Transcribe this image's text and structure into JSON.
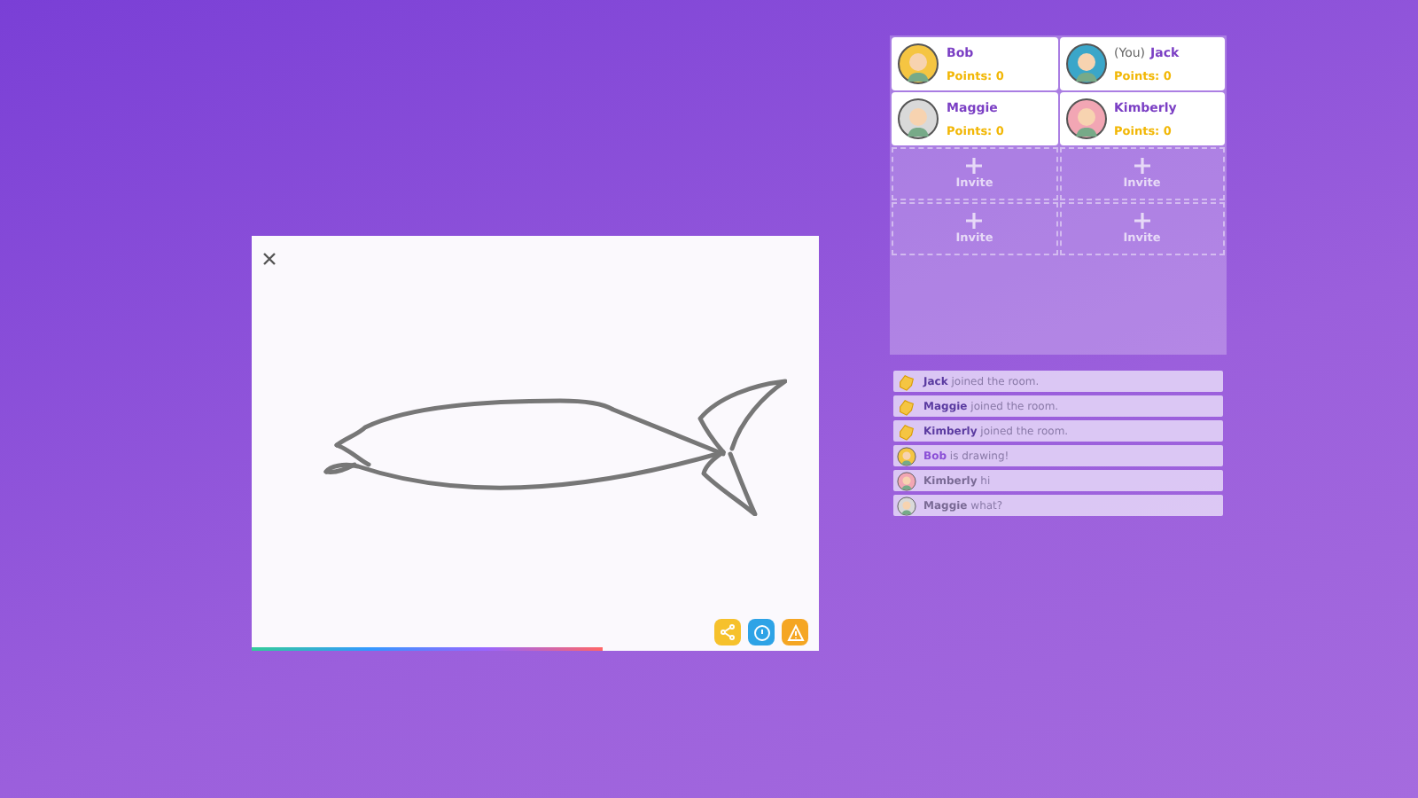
{
  "players": [
    {
      "name": "Bob",
      "points": "Points: 0",
      "color": "#f5c542"
    },
    {
      "name": "Jack",
      "you_label": "(You)",
      "points": "Points: 0",
      "color": "#3aa6c9"
    },
    {
      "name": "Maggie",
      "points": "Points: 0",
      "color": "#d9d9d9"
    },
    {
      "name": "Kimberly",
      "points": "Points: 0",
      "color": "#f2a6b4"
    }
  ],
  "invites": [
    "Invite",
    "Invite",
    "Invite",
    "Invite"
  ],
  "chat": [
    {
      "kind": "join",
      "name": "Jack",
      "text": "joined the room."
    },
    {
      "kind": "join",
      "name": "Maggie",
      "text": "joined the room."
    },
    {
      "kind": "join",
      "name": "Kimberly",
      "text": "joined the room."
    },
    {
      "kind": "drawing",
      "name": "Bob",
      "text": "is drawing!",
      "color": "#f5c542"
    },
    {
      "kind": "chat",
      "name": "Kimberly",
      "text": "hi",
      "color": "#f2a6b4"
    },
    {
      "kind": "chat",
      "name": "Maggie",
      "text": "what?",
      "color": "#d9d9d9"
    }
  ],
  "timer": {
    "level": 0.62
  }
}
